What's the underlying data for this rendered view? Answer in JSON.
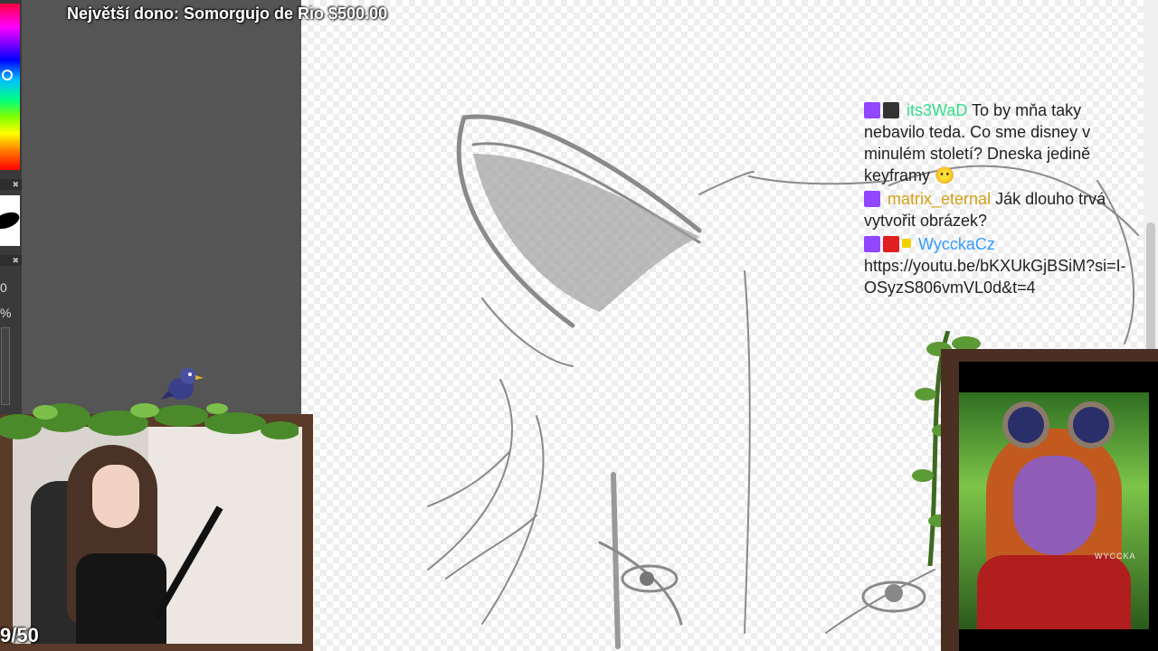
{
  "overlay": {
    "top_donor": "Největší dono: Somorgujo de Rio $500.00",
    "counter": "9/50"
  },
  "tool_panel": {
    "value_1": "0",
    "value_2": "%"
  },
  "chat": {
    "messages": [
      {
        "username": "its3WaD",
        "username_color": "#33dd88",
        "text": "To by mňa taky nebavilo teda. Co sme disney v minulém století? Dneska jedině keyframy",
        "emoji": "😶"
      },
      {
        "username": "matrix_eternal",
        "username_color": "#d4a017",
        "text": "Ják dlouho trvá vytvořit obrázek?"
      },
      {
        "username": "WycckaCz",
        "username_color": "#3399ff",
        "text": "https://youtu.be/bKXUkGjBSiM?si=I-OSyzS806vmVL0d&t=4"
      }
    ]
  },
  "avatar": {
    "watermark": "WYCCKA"
  },
  "colors": {
    "twitch": "#9146ff",
    "frame_wood": "#5a3a28"
  }
}
